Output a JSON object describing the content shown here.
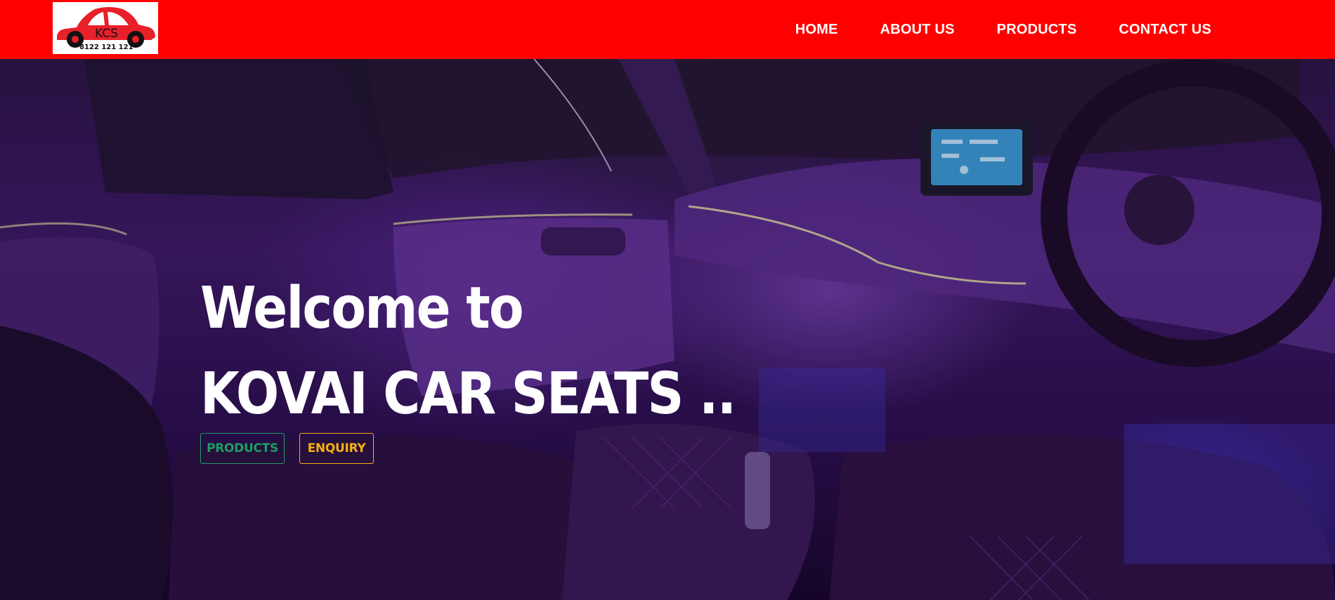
{
  "header": {
    "logo": {
      "text": "KCS",
      "phone": "8122 121 121",
      "icon": "car-logo-icon"
    },
    "nav": [
      {
        "label": "HOME"
      },
      {
        "label": "ABOUT US"
      },
      {
        "label": "PRODUCTS"
      },
      {
        "label": "CONTACT US"
      }
    ],
    "colors": {
      "background": "#ff0000",
      "text": "#ffffff"
    }
  },
  "hero": {
    "title_line1": "Welcome to",
    "title_line2": "KOVAI CAR SEATS ..",
    "image": "car-interior-ambient-light-image",
    "buttons": {
      "products_label": "PRODUCTS",
      "enquiry_label": "ENQUIRY"
    },
    "colors": {
      "products": "#1f9d64",
      "enquiry": "#f5b017"
    }
  }
}
